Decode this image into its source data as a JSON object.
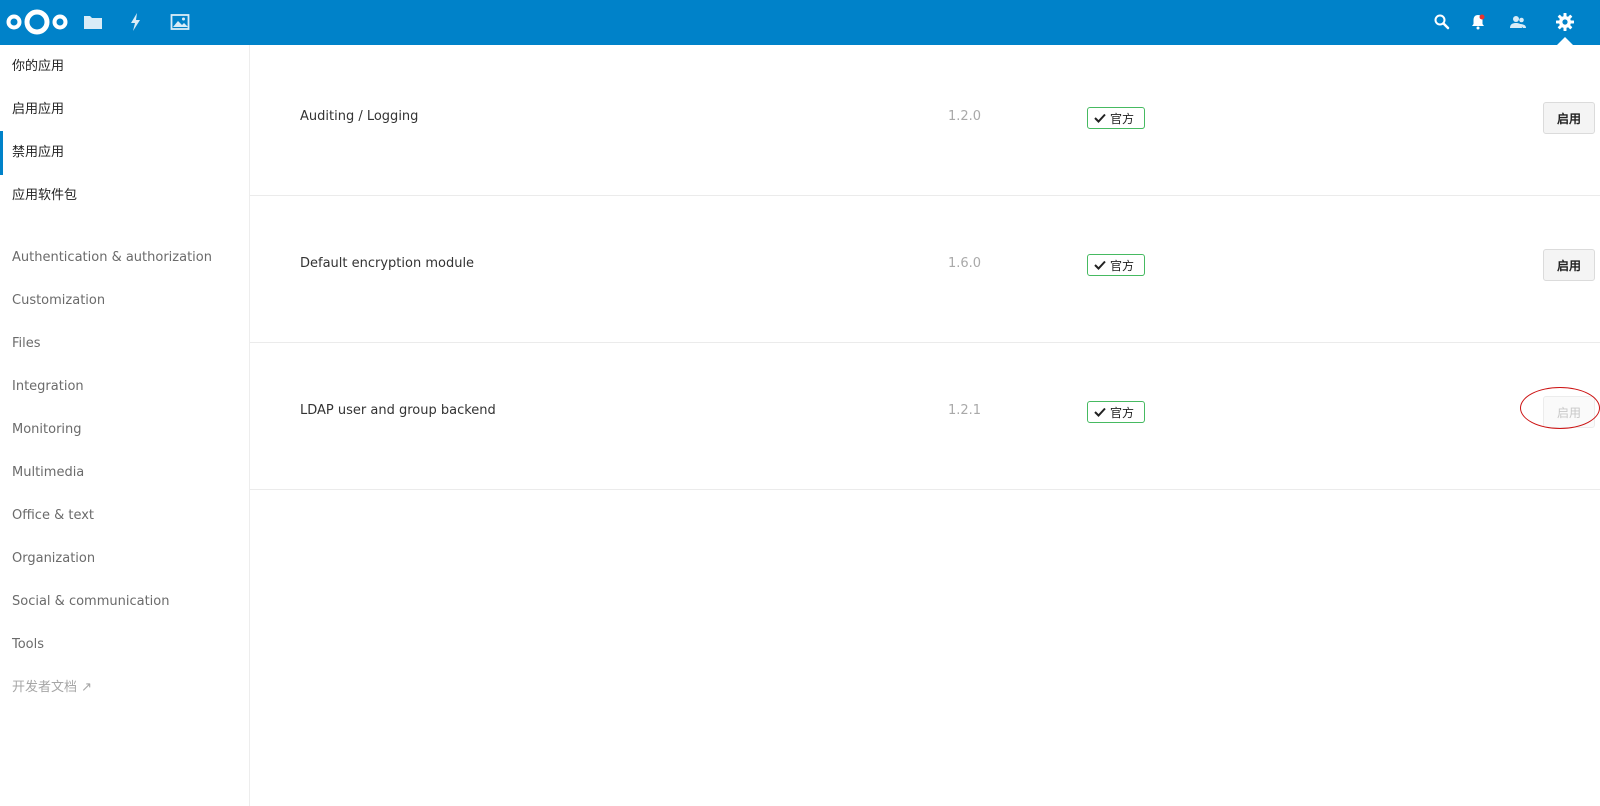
{
  "header": {
    "apps": [
      {
        "icon": "files-icon"
      },
      {
        "icon": "activity-icon"
      },
      {
        "icon": "gallery-icon"
      }
    ],
    "right": [
      {
        "icon": "search-icon"
      },
      {
        "icon": "notifications-icon"
      },
      {
        "icon": "contacts-icon"
      },
      {
        "icon": "settings-icon"
      }
    ],
    "brand_color": "#0082c9"
  },
  "sidebar": {
    "items": [
      {
        "label": "你的应用"
      },
      {
        "label": "启用应用"
      },
      {
        "label": "禁用应用",
        "active": true
      },
      {
        "label": "应用软件包"
      }
    ],
    "categories": [
      {
        "label": "Authentication & authorization"
      },
      {
        "label": "Customization"
      },
      {
        "label": "Files"
      },
      {
        "label": "Integration"
      },
      {
        "label": "Monitoring"
      },
      {
        "label": "Multimedia"
      },
      {
        "label": "Office & text"
      },
      {
        "label": "Organization"
      },
      {
        "label": "Social & communication"
      },
      {
        "label": "Tools"
      }
    ],
    "developer_docs": "开发者文档 ↗"
  },
  "apps": [
    {
      "name": "Auditing / Logging",
      "version": "1.2.0",
      "badge": "官方",
      "button": "启用",
      "button_disabled": false
    },
    {
      "name": "Default encryption module",
      "version": "1.6.0",
      "badge": "官方",
      "button": "启用",
      "button_disabled": false
    },
    {
      "name": "LDAP user and group backend",
      "version": "1.2.1",
      "badge": "官方",
      "button": "启用",
      "button_disabled": true
    }
  ]
}
